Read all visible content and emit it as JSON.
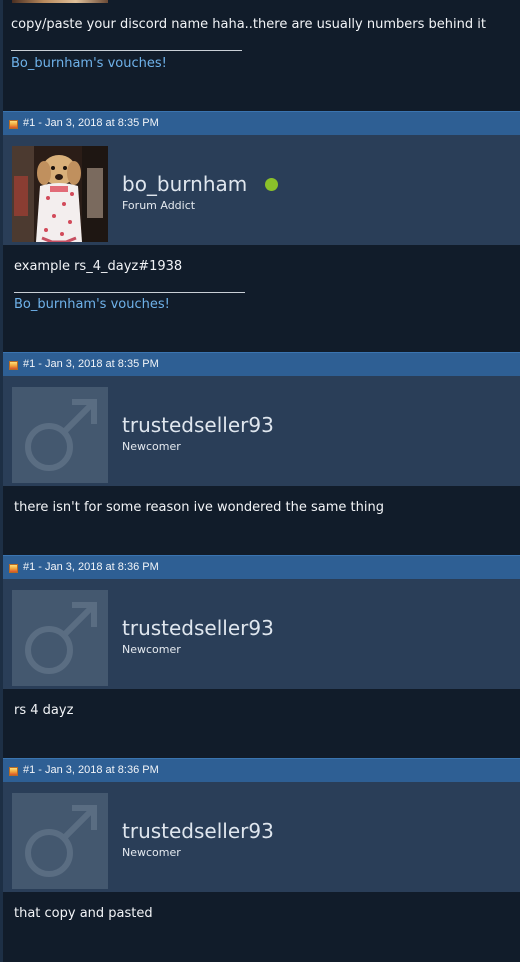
{
  "top_post": {
    "message": "copy/paste your discord name haha..there are usually numbers behind it",
    "signature_link": "Bo_burnham's vouches!"
  },
  "posts": [
    {
      "header": "#1 - Jan 3, 2018 at 8:35 PM",
      "username": "bo_burnham",
      "user_title": "Forum Addict",
      "online": true,
      "avatar": "photo-avatar",
      "message": "example rs_4_dayz#1938",
      "signature_link": "Bo_burnham's vouches!"
    },
    {
      "header": "#1 - Jan 3, 2018 at 8:35 PM",
      "username": "trustedseller93",
      "user_title": "Newcomer",
      "avatar": "default-male-avatar",
      "message": "there isn't for some reason ive wondered the same thing"
    },
    {
      "header": "#1 - Jan 3, 2018 at 8:36 PM",
      "username": "trustedseller93",
      "user_title": "Newcomer",
      "avatar": "default-male-avatar",
      "message": "rs 4 dayz"
    },
    {
      "header": "#1 - Jan 3, 2018 at 8:36 PM",
      "username": "trustedseller93",
      "user_title": "Newcomer",
      "avatar": "default-male-avatar",
      "message": "that copy and pasted"
    }
  ],
  "colors": {
    "page_bg": "#111c2a",
    "header_bg": "#2e5f94",
    "user_block_bg": "#2a3e58",
    "link": "#6fb2ea",
    "online": "#8ac02a"
  }
}
